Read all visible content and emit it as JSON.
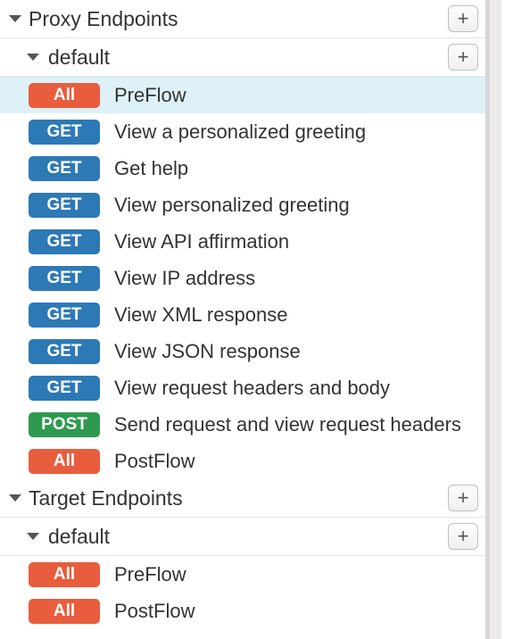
{
  "sections": [
    {
      "title": "Proxy Endpoints",
      "groups": [
        {
          "name": "default",
          "flows": [
            {
              "method": "All",
              "label": "PreFlow",
              "selected": true
            },
            {
              "method": "GET",
              "label": "View a personalized greeting"
            },
            {
              "method": "GET",
              "label": "Get help"
            },
            {
              "method": "GET",
              "label": "View personalized greeting"
            },
            {
              "method": "GET",
              "label": "View API affirmation"
            },
            {
              "method": "GET",
              "label": "View IP address"
            },
            {
              "method": "GET",
              "label": "View XML response"
            },
            {
              "method": "GET",
              "label": "View JSON response"
            },
            {
              "method": "GET",
              "label": "View request headers and body"
            },
            {
              "method": "POST",
              "label": "Send request and view request headers"
            },
            {
              "method": "All",
              "label": "PostFlow"
            }
          ]
        }
      ]
    },
    {
      "title": "Target Endpoints",
      "groups": [
        {
          "name": "default",
          "flows": [
            {
              "method": "All",
              "label": "PreFlow"
            },
            {
              "method": "All",
              "label": "PostFlow"
            }
          ]
        }
      ]
    }
  ],
  "icons": {
    "add": "+"
  }
}
